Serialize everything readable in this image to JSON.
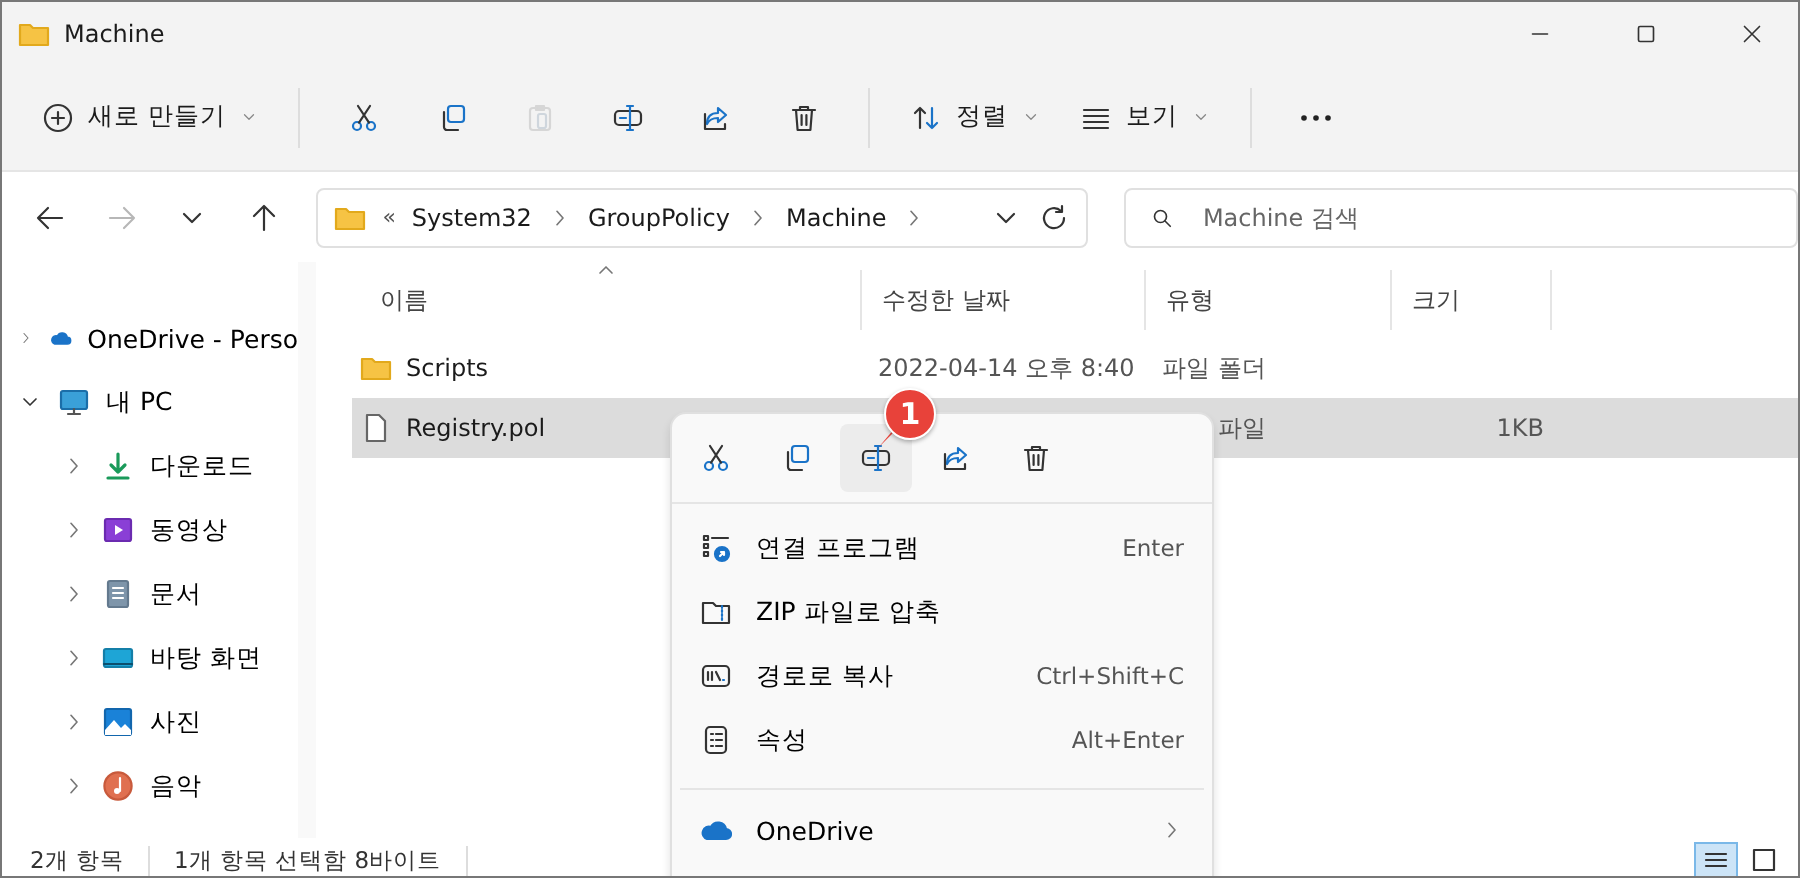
{
  "window": {
    "title": "Machine"
  },
  "toolbar": [
    {
      "kind": "new",
      "label": "새로 만들기",
      "disabled": false
    },
    {
      "kind": "cut",
      "disabled": false
    },
    {
      "kind": "copy",
      "disabled": false
    },
    {
      "kind": "paste",
      "disabled": true
    },
    {
      "kind": "rename",
      "disabled": false
    },
    {
      "kind": "share",
      "disabled": false
    },
    {
      "kind": "delete",
      "disabled": false
    },
    {
      "kind": "sort",
      "label": "정렬",
      "disabled": false
    },
    {
      "kind": "view",
      "label": "보기",
      "disabled": false
    },
    {
      "kind": "more",
      "disabled": false
    }
  ],
  "navigation": [
    {
      "kind": "back",
      "disabled": false
    },
    {
      "kind": "forward",
      "disabled": true
    },
    {
      "kind": "recent",
      "disabled": false
    },
    {
      "kind": "up",
      "disabled": false
    }
  ],
  "address": {
    "overflow": "«",
    "segments": [
      "System32",
      "GroupPolicy",
      "Machine"
    ]
  },
  "search": {
    "placeholder": "Machine 검색"
  },
  "sidebar": {
    "items": [
      {
        "kind": "onedrive",
        "label": "OneDrive - Perso",
        "expanded": false
      },
      {
        "kind": "pc",
        "label": "내 PC",
        "expanded": true,
        "children": [
          {
            "kind": "download",
            "label": "다운로드",
            "expanded": false
          },
          {
            "kind": "video",
            "label": "동영상",
            "expanded": false
          },
          {
            "kind": "documents",
            "label": "문서",
            "expanded": false
          },
          {
            "kind": "desktop",
            "label": "바탕 화면",
            "expanded": false
          },
          {
            "kind": "pictures",
            "label": "사진",
            "expanded": false
          },
          {
            "kind": "music",
            "label": "음악",
            "expanded": false
          }
        ]
      }
    ]
  },
  "table": {
    "columns": [
      {
        "label": "이름",
        "sorted": true
      },
      {
        "label": "수정한 날짜",
        "sorted": false
      },
      {
        "label": "유형",
        "sorted": false
      },
      {
        "label": "크기",
        "sorted": false
      }
    ],
    "rows": [
      {
        "kind": "folder",
        "name": "Scripts",
        "date": "2022-04-14 오후 8:40",
        "type": "파일 폴더",
        "selected": false
      },
      {
        "kind": "file",
        "name": "Registry.pol",
        "type": "파일",
        "size": "1KB",
        "selected": true
      }
    ]
  },
  "context_menu": {
    "quick_actions": [
      {
        "kind": "cut",
        "highlighted": false
      },
      {
        "kind": "copy",
        "highlighted": false
      },
      {
        "kind": "rename",
        "highlighted": true
      },
      {
        "kind": "share",
        "highlighted": false
      },
      {
        "kind": "delete",
        "highlighted": false
      }
    ],
    "items": [
      {
        "kind": "open-with",
        "label": "연결 프로그램",
        "shortcut": "Enter"
      },
      {
        "kind": "zip",
        "label": "ZIP 파일로 압축"
      },
      {
        "kind": "copy-path",
        "label": "경로로 복사",
        "shortcut": "Ctrl+Shift+C"
      },
      {
        "kind": "properties",
        "label": "속성",
        "shortcut": "Alt+Enter"
      },
      {
        "kind": "onedrive",
        "label": "OneDrive",
        "submenu": true
      }
    ]
  },
  "annotation": {
    "label": "1"
  },
  "status_bar": [
    "2개 항목",
    "1개 항목 선택함 8바이트"
  ],
  "view_buttons": [
    {
      "kind": "details",
      "selected": true
    },
    {
      "kind": "tiles",
      "selected": false
    }
  ]
}
